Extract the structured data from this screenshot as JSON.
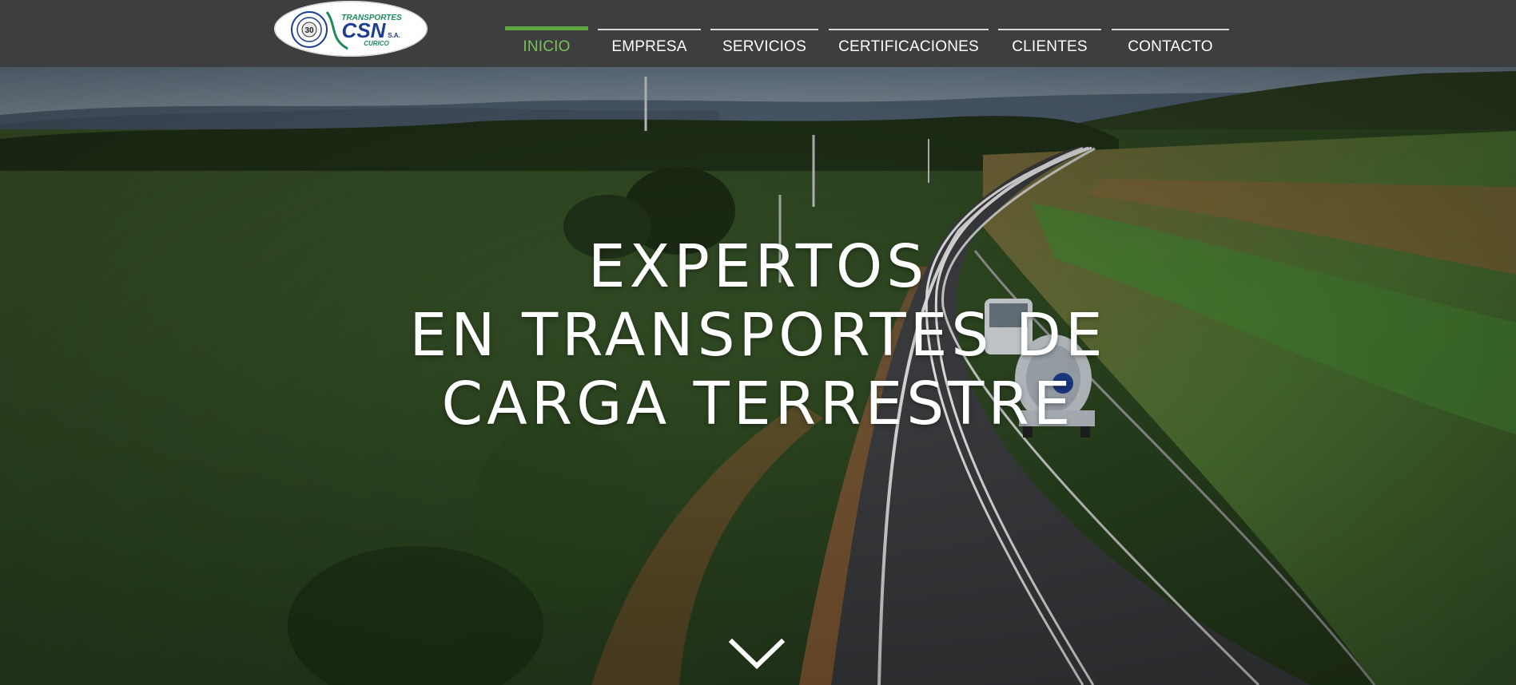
{
  "brand": {
    "logo_top_text": "TRANSPORTES",
    "logo_main_text": "CSN",
    "logo_suffix": "S.A.",
    "logo_bottom_text": "CURICO",
    "logo_seal_number": "30"
  },
  "nav": {
    "items": [
      {
        "label": "INICIO",
        "active": true
      },
      {
        "label": "EMPRESA",
        "active": false
      },
      {
        "label": "SERVICIOS",
        "active": false
      },
      {
        "label": "CERTIFICACIONES",
        "active": false
      },
      {
        "label": "CLIENTES",
        "active": false
      },
      {
        "label": "CONTACTO",
        "active": false
      }
    ]
  },
  "hero": {
    "headline_line1": "EXPERTOS",
    "headline_line2": "EN TRANSPORTES DE",
    "headline_line3": "CARGA TERRESTRE",
    "scroll_icon": "chevron-down-icon"
  },
  "colors": {
    "topbar": "#3f3e3e",
    "accent_green": "#5fa741",
    "logo_green": "#1c8a5a",
    "logo_blue": "#1e3f8f"
  }
}
